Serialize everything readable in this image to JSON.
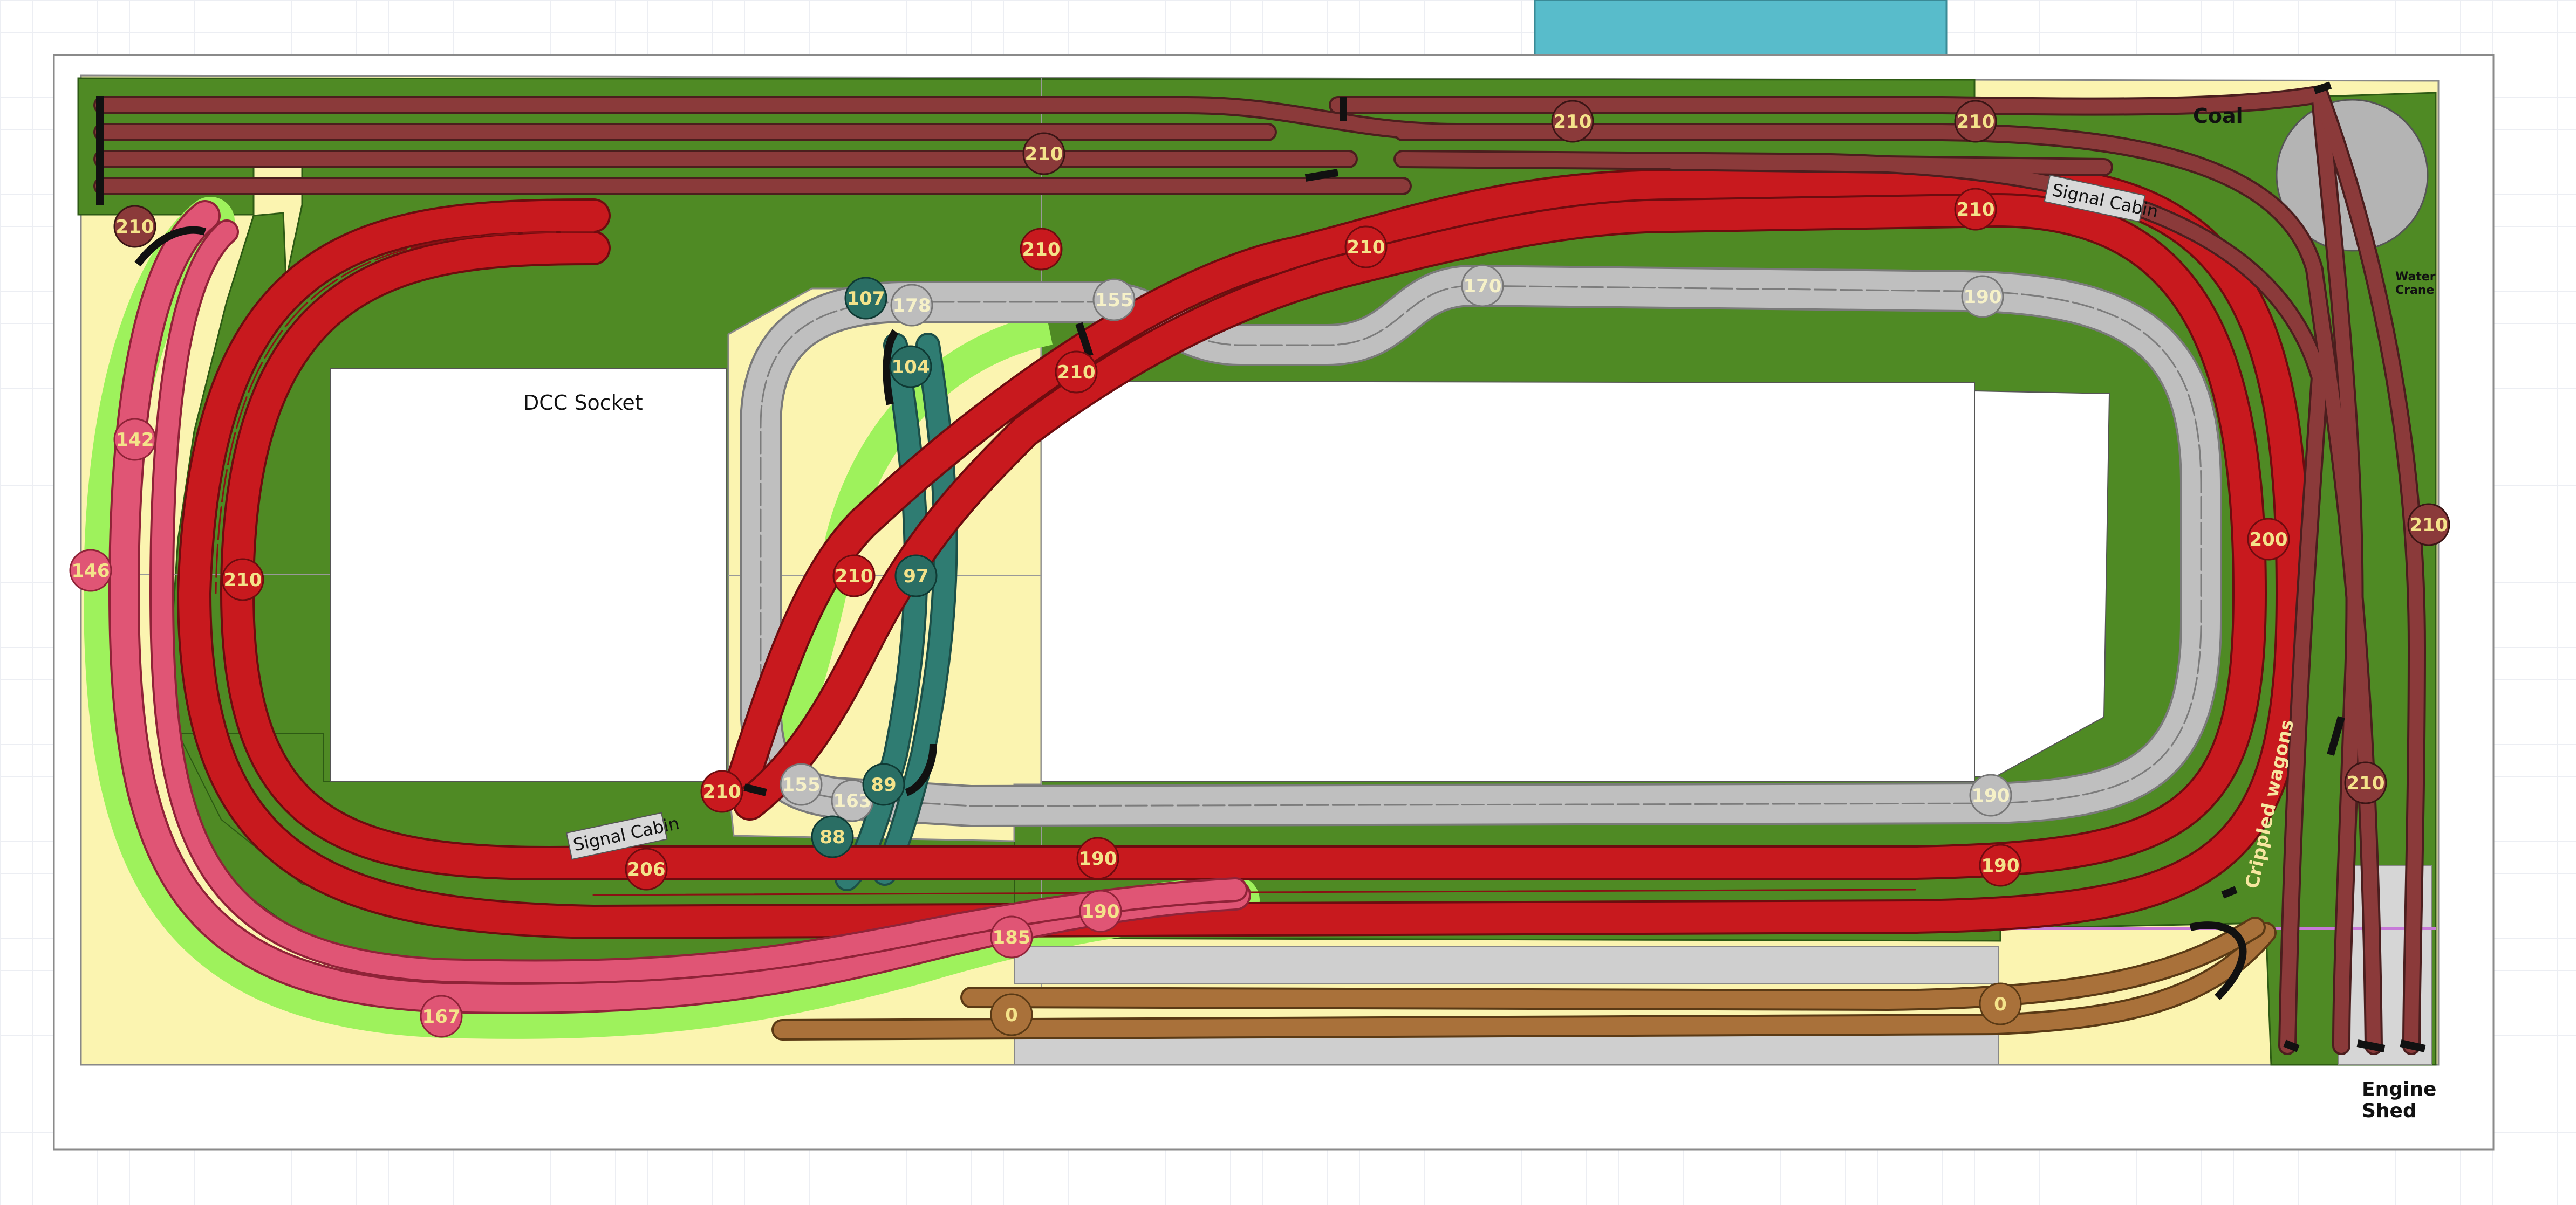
{
  "labels": {
    "dcc_socket": "DCC Socket",
    "coal": "Coal",
    "water_crane": [
      "Water",
      "Crane"
    ],
    "signal_cabin_top": "Signal Cabin",
    "signal_cabin_bottom": "Signal Cabin",
    "crippled_wagons": "Crippled wagons",
    "engine_shed": [
      "Engine",
      "Shed"
    ]
  },
  "colors": {
    "baseboard_green": "#4f8a24",
    "cutout_yellow": "#fbf4b0",
    "main_red": "#c8191e",
    "yard_brown": "#8b3a3a",
    "low_line_pink": "#dd4a6a",
    "light_green_bed": "#9ef25c",
    "grey_loop": "#b6b6b6",
    "teal_line": "#2a6e64",
    "lower_brown": "#a9713a",
    "water_blue": "#58bccb"
  },
  "height_markers": [
    {
      "id": "m1",
      "v": "210",
      "c": "brown"
    },
    {
      "id": "m2",
      "v": "210",
      "c": "brown"
    },
    {
      "id": "m3",
      "v": "210",
      "c": "brown"
    },
    {
      "id": "m4",
      "v": "210",
      "c": "brown"
    },
    {
      "id": "m5",
      "v": "210",
      "c": "red"
    },
    {
      "id": "m6",
      "v": "210",
      "c": "red"
    },
    {
      "id": "m7",
      "v": "210",
      "c": "red"
    },
    {
      "id": "m8",
      "v": "107",
      "c": "teal"
    },
    {
      "id": "m9",
      "v": "178",
      "c": "grey"
    },
    {
      "id": "m10",
      "v": "155",
      "c": "grey"
    },
    {
      "id": "m11",
      "v": "170",
      "c": "grey"
    },
    {
      "id": "m12",
      "v": "190",
      "c": "grey"
    },
    {
      "id": "m13",
      "v": "104",
      "c": "teal"
    },
    {
      "id": "m14",
      "v": "210",
      "c": "red"
    },
    {
      "id": "m15",
      "v": "142",
      "c": "pink"
    },
    {
      "id": "m16",
      "v": "146",
      "c": "pink"
    },
    {
      "id": "m17",
      "v": "210",
      "c": "red"
    },
    {
      "id": "m18",
      "v": "210",
      "c": "red"
    },
    {
      "id": "m19",
      "v": "97",
      "c": "teal"
    },
    {
      "id": "m20",
      "v": "200",
      "c": "red"
    },
    {
      "id": "m21",
      "v": "210",
      "c": "brown"
    },
    {
      "id": "m22",
      "v": "210",
      "c": "red"
    },
    {
      "id": "m23",
      "v": "155",
      "c": "grey"
    },
    {
      "id": "m24",
      "v": "163",
      "c": "grey"
    },
    {
      "id": "m25",
      "v": "89",
      "c": "teal"
    },
    {
      "id": "m26",
      "v": "88",
      "c": "teal"
    },
    {
      "id": "m27",
      "v": "190",
      "c": "grey"
    },
    {
      "id": "m28",
      "v": "210",
      "c": "brown"
    },
    {
      "id": "m29",
      "v": "206",
      "c": "red"
    },
    {
      "id": "m30",
      "v": "190",
      "c": "red"
    },
    {
      "id": "m31",
      "v": "190",
      "c": "red"
    },
    {
      "id": "m32",
      "v": "190",
      "c": "pink"
    },
    {
      "id": "m33",
      "v": "185",
      "c": "pink"
    },
    {
      "id": "m34",
      "v": "167",
      "c": "pink"
    },
    {
      "id": "m35",
      "v": "0",
      "c": "lbrown"
    },
    {
      "id": "m36",
      "v": "0",
      "c": "lbrown"
    },
    {
      "id": "m37",
      "v": "210",
      "c": "brown"
    }
  ]
}
